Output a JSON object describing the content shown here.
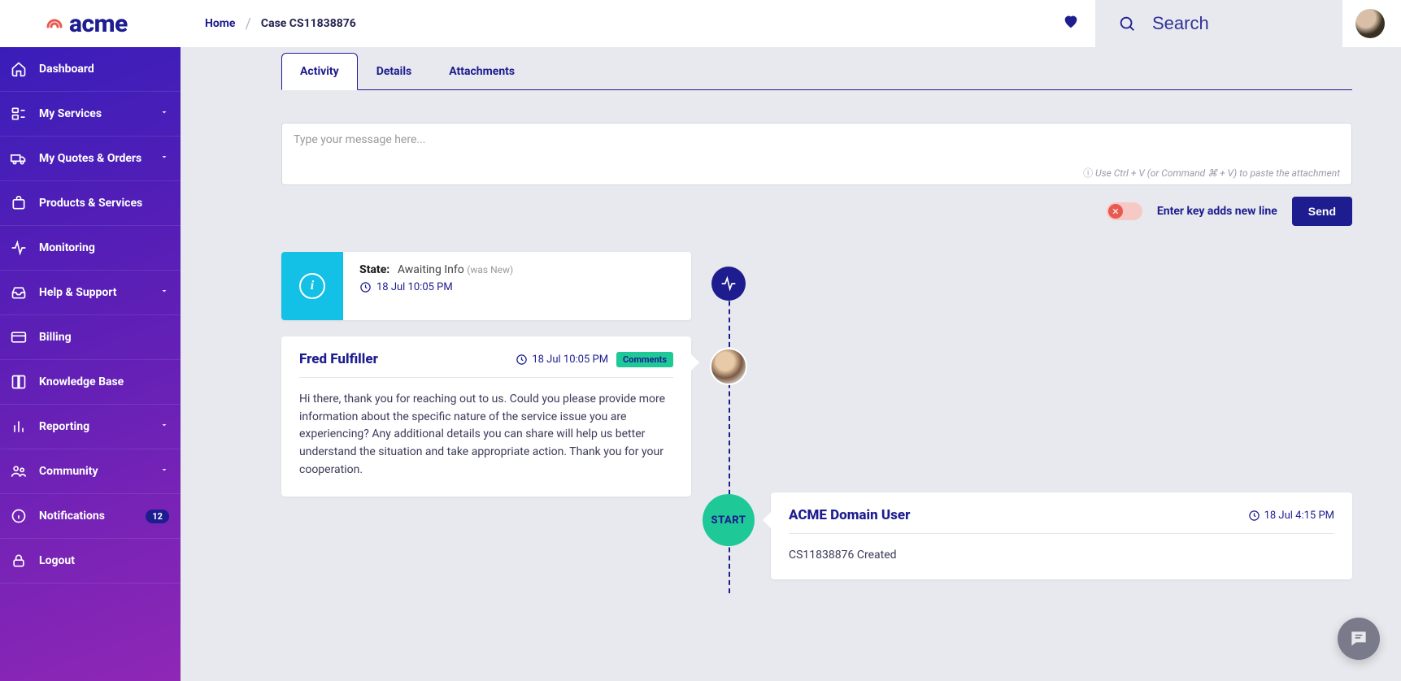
{
  "brand": "acme",
  "breadcrumb": {
    "home": "Home",
    "current": "Case CS11838876"
  },
  "search": {
    "placeholder": "Search"
  },
  "sidebar": [
    {
      "key": "dashboard",
      "label": "Dashboard",
      "icon": "home",
      "expandable": false
    },
    {
      "key": "services",
      "label": "My Services",
      "icon": "services",
      "expandable": true
    },
    {
      "key": "quotes",
      "label": "My Quotes & Orders",
      "icon": "truck",
      "expandable": true
    },
    {
      "key": "products",
      "label": "Products & Services",
      "icon": "bag",
      "expandable": false
    },
    {
      "key": "monitoring",
      "label": "Monitoring",
      "icon": "activity",
      "expandable": false
    },
    {
      "key": "help",
      "label": "Help & Support",
      "icon": "inbox",
      "expandable": true
    },
    {
      "key": "billing",
      "label": "Billing",
      "icon": "card",
      "expandable": false
    },
    {
      "key": "kb",
      "label": "Knowledge Base",
      "icon": "book",
      "expandable": false
    },
    {
      "key": "reporting",
      "label": "Reporting",
      "icon": "bars",
      "expandable": true
    },
    {
      "key": "community",
      "label": "Community",
      "icon": "people",
      "expandable": true
    },
    {
      "key": "notifications",
      "label": "Notifications",
      "icon": "info",
      "expandable": false,
      "badge": "12"
    },
    {
      "key": "logout",
      "label": "Logout",
      "icon": "lock",
      "expandable": false
    }
  ],
  "tabs": [
    {
      "label": "Activity",
      "active": true
    },
    {
      "label": "Details",
      "active": false
    },
    {
      "label": "Attachments",
      "active": false
    }
  ],
  "compose": {
    "placeholder": "Type your message here...",
    "hint": "Use Ctrl + V (or Command ⌘ + V) to paste the attachment",
    "enter_toggle_label": "Enter key adds new line",
    "send_label": "Send"
  },
  "timeline": {
    "state_change": {
      "field_label": "State:",
      "new_value": "Awaiting Info",
      "was_value": "(was New)",
      "timestamp": "18 Jul 10:05 PM"
    },
    "comment": {
      "author": "Fred Fulfiller",
      "timestamp": "18 Jul 10:05 PM",
      "tag": "Comments",
      "body": "Hi there, thank you for reaching out to us. Could you please provide more information about the specific nature of the service issue you are experiencing? Any additional details you can share will help us better understand the situation and take appropriate action. Thank you for your cooperation."
    },
    "start_label": "START",
    "created": {
      "author": "ACME Domain User",
      "timestamp": "18 Jul 4:15 PM",
      "body": "CS11838876 Created"
    }
  }
}
